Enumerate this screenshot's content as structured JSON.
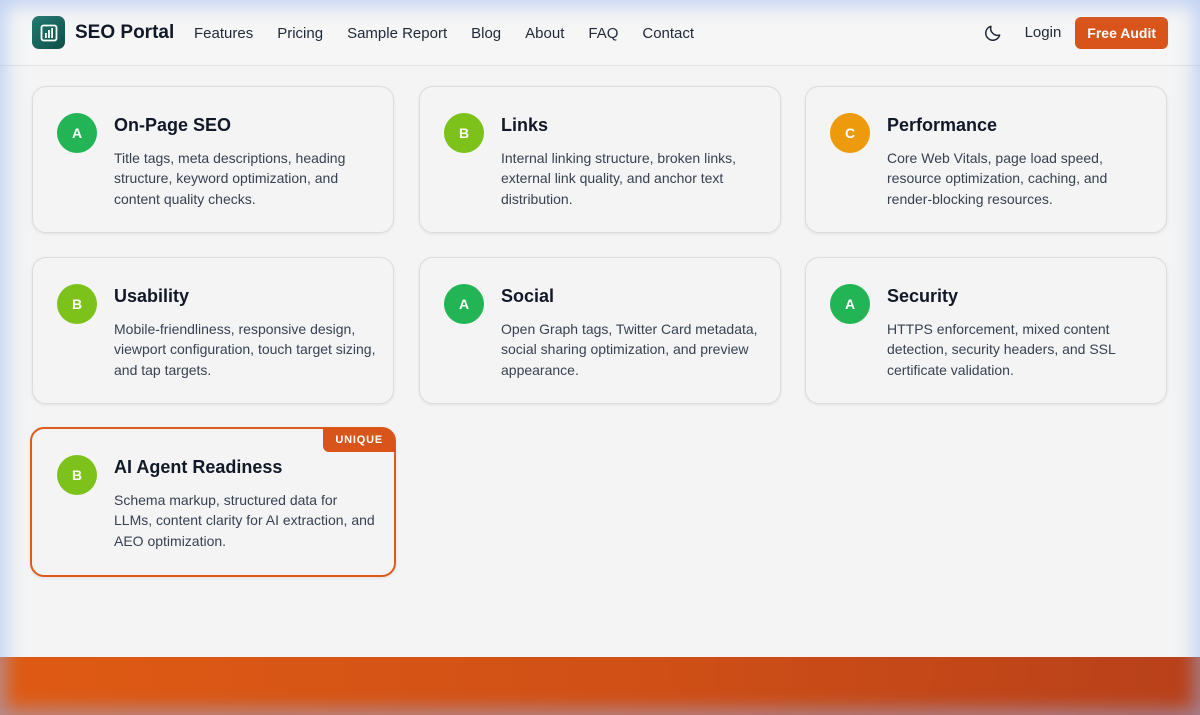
{
  "nav": {
    "brand": "SEO Portal",
    "links": [
      "Features",
      "Pricing",
      "Sample Report",
      "Blog",
      "About",
      "FAQ",
      "Contact"
    ],
    "login": "Login",
    "cta": "Free Audit"
  },
  "colors": {
    "accent": "#d9541a",
    "grade_A": "#22b455",
    "grade_B": "#7cc21b",
    "grade_C": "#ed9b0d"
  },
  "cards": [
    {
      "grade": "A",
      "title": "On-Page SEO",
      "desc": "Title tags, meta descriptions, heading structure, keyword optimization, and content quality checks."
    },
    {
      "grade": "B",
      "title": "Links",
      "desc": "Internal linking structure, broken links, external link quality, and anchor text distribution."
    },
    {
      "grade": "C",
      "title": "Performance",
      "desc": "Core Web Vitals, page load speed, resource optimization, caching, and render-blocking resources."
    },
    {
      "grade": "B",
      "title": "Usability",
      "desc": "Mobile-friendliness, responsive design, viewport configuration, touch target sizing, and tap targets."
    },
    {
      "grade": "A",
      "title": "Social",
      "desc": "Open Graph tags, Twitter Card metadata, social sharing optimization, and preview appearance."
    },
    {
      "grade": "A",
      "title": "Security",
      "desc": "HTTPS enforcement, mixed content detection, security headers, and SSL certificate validation."
    },
    {
      "grade": "B",
      "title": "AI Agent Readiness",
      "desc": "Schema markup, structured data for LLMs, content clarity for AI extraction, and AEO optimization.",
      "tag": "UNIQUE"
    }
  ]
}
